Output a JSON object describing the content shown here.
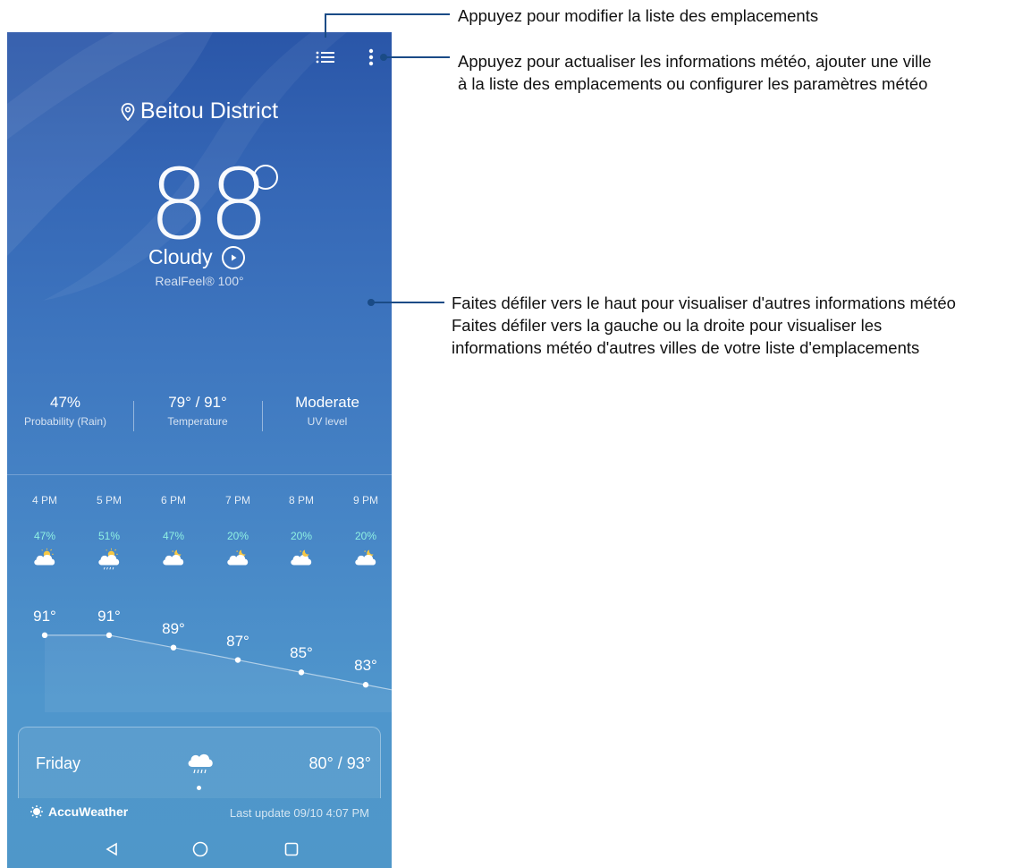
{
  "location": {
    "name": "Beitou District",
    "icon": "location-pin-icon"
  },
  "current": {
    "temperature": "88",
    "condition": "Cloudy",
    "realfeel": "RealFeel® 100°"
  },
  "stats": [
    {
      "value": "47%",
      "label": "Probability (Rain)"
    },
    {
      "value": "79° / 91°",
      "label": "Temperature"
    },
    {
      "value": "Moderate",
      "label": "UV level"
    }
  ],
  "hourly": [
    {
      "time": "4 PM",
      "precip": "47%",
      "temp": "91°",
      "temp_value": 91,
      "icon": "partly-sunny-cloud-icon"
    },
    {
      "time": "5 PM",
      "precip": "51%",
      "temp": "91°",
      "temp_value": 91,
      "icon": "sun-cloud-rain-icon"
    },
    {
      "time": "6 PM",
      "precip": "47%",
      "temp": "89°",
      "temp_value": 89,
      "icon": "moon-cloud-icon"
    },
    {
      "time": "7 PM",
      "precip": "20%",
      "temp": "87°",
      "temp_value": 87,
      "icon": "moon-cloud-icon"
    },
    {
      "time": "8 PM",
      "precip": "20%",
      "temp": "85°",
      "temp_value": 85,
      "icon": "cloud-moon-icon"
    },
    {
      "time": "9 PM",
      "precip": "20%",
      "temp": "83°",
      "temp_value": 83,
      "icon": "moon-cloud-icon"
    }
  ],
  "daily": {
    "day": "Friday",
    "range": "80° / 93°",
    "icon": "cloud-rain-icon"
  },
  "footer": {
    "brand": "AccuWeather",
    "last_update": "Last update 09/10 4:07 PM"
  },
  "callouts": {
    "list": "Appuyez pour modifier la liste des emplacements",
    "menu_line1": "Appuyez pour actualiser les informations météo, ajouter une ville",
    "menu_line2": "à la liste des emplacements ou configurer les paramètres météo",
    "scroll_line1": "Faites défiler vers le haut pour visualiser d'autres informations météo",
    "scroll_line2": "Faites défiler vers la gauche ou la droite pour visualiser les",
    "scroll_line3": "informations météo d'autres villes de votre liste d'emplacements"
  },
  "colors": {
    "accent_precip": "#8ff0e3",
    "callout_line": "#1a4b86"
  }
}
